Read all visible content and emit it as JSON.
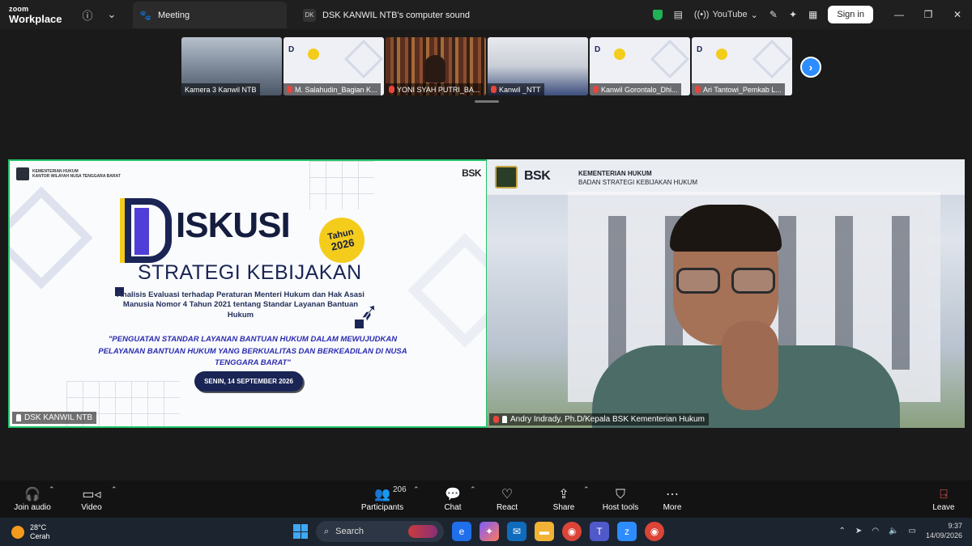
{
  "app": {
    "logo_line1": "zoom",
    "logo_line2": "Workplace",
    "tabs": [
      {
        "label": "Meeting"
      },
      {
        "badge": "DK",
        "label": "DSK KANWIL NTB's computer sound"
      }
    ],
    "youtube_label": "YouTube",
    "signin_label": "Sign in"
  },
  "thumbnails": [
    {
      "label": "Kamera 3 Kanwil NTB",
      "muted": false
    },
    {
      "label": "M. Salahudin_Bagian K...",
      "muted": true
    },
    {
      "label": "YONI SYAH PUTRI_BA...",
      "muted": true
    },
    {
      "label": "Kanwil _NTT",
      "muted": true
    },
    {
      "label": "Kanwil Gorontalo_Dhi...",
      "muted": true
    },
    {
      "label": "Ari Tantowi_Pemkab L...",
      "muted": true
    }
  ],
  "slide": {
    "org_line1": "KEMENTERIAN HUKUM",
    "org_line2": "KANTOR WILAYAH NUSA TENGGARA BARAT",
    "bsk": "BSK",
    "title": "ISKUSI",
    "tahun_line1": "Tahun",
    "tahun_line2": "2026",
    "subtitle": "STRATEGI KEBIJAKAN",
    "analisis": "Analisis Evaluasi terhadap Peraturan Menteri Hukum dan Hak Asasi Manusia Nomor 4 Tahun 2021 tentang Standar Layanan Bantuan Hukum",
    "tagline": "\"PENGUATAN STANDAR LAYANAN BANTUAN HUKUM DALAM MEWUJUDKAN PELAYANAN BANTUAN HUKUM YANG BERKUALITAS DAN BERKEADILAN DI NUSA TENGGARA BARAT\"",
    "date": "SENIN, 14 SEPTEMBER 2026"
  },
  "videos": {
    "left_label": "DSK KANWIL NTB",
    "right_label": "Andry Indrady, Ph.D/Kepala BSK Kementerian Hukum",
    "right_bsk": "BSK",
    "right_org_line1": "KEMENTERIAN HUKUM",
    "right_org_line2": "BADAN STRATEGI KEBIJAKAN HUKUM"
  },
  "toolbar": {
    "join_audio": "Join audio",
    "video": "Video",
    "participants": "Participants",
    "participants_count": "206",
    "chat": "Chat",
    "react": "React",
    "share": "Share",
    "host_tools": "Host tools",
    "more": "More",
    "leave": "Leave"
  },
  "taskbar": {
    "temp": "28°C",
    "weather": "Cerah",
    "search": "Search",
    "time": "9:37",
    "date": "14/09/2026"
  },
  "colors": {
    "active_speaker_border": "#21c46a",
    "accent_blue": "#2d8cff",
    "slide_navy": "#1a2555",
    "slide_yellow": "#f4cc1b",
    "leave_red": "#ff5b5b"
  }
}
